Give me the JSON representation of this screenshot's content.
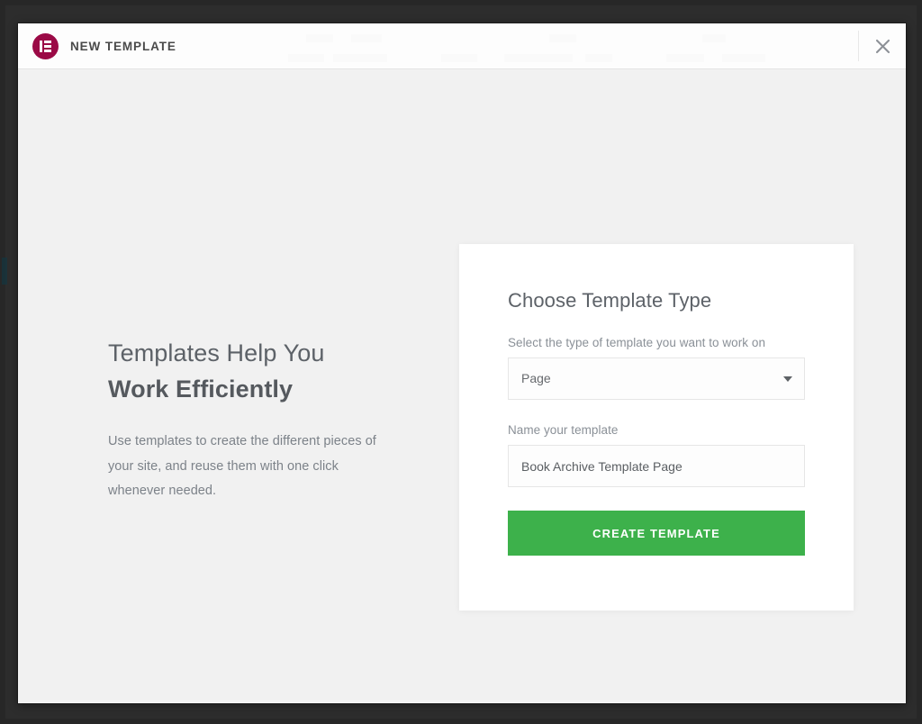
{
  "window": {
    "frame_color": "#272727",
    "background_color": "#f1f1f1"
  },
  "header": {
    "title": "NEW TEMPLATE",
    "logo_icon": "elementor-logo-icon",
    "logo_color": "#9b0a46",
    "close_icon": "close-icon"
  },
  "intro": {
    "title_line1": "Templates Help You",
    "title_line2": "Work Efficiently",
    "paragraph": "Use templates to create the different pieces of your site, and reuse them with one click whenever needed."
  },
  "form": {
    "card_title": "Choose Template Type",
    "type_label": "Select the type of template you want to work on",
    "type_value": "Page",
    "type_options": [
      "Page"
    ],
    "type_caret_icon": "chevron-down-icon",
    "name_label": "Name your template",
    "name_value": "Book Archive Template Page",
    "name_placeholder": "Name your template",
    "submit_label": "CREATE TEMPLATE",
    "submit_color": "#3db14b"
  }
}
